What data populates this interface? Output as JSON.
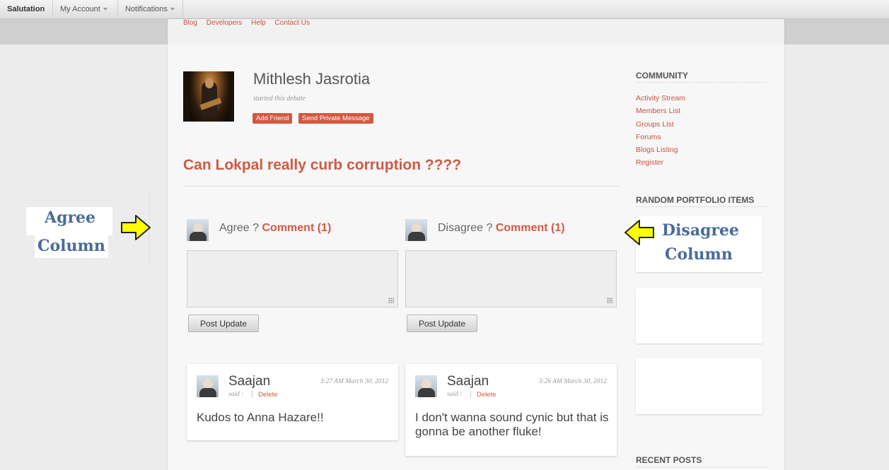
{
  "topbar": {
    "brand": "Salutation",
    "account": "My Account",
    "notifications": "Notifications"
  },
  "nav": [
    "Blog",
    "Developers",
    "Help",
    "Contact Us"
  ],
  "profile": {
    "name": "Mithlesh Jasrotia",
    "subtitle": "started this debate",
    "add_friend": "Add Friend",
    "send_message": "Send Private Message"
  },
  "debate": {
    "title": "Can Lokpal really curb corruption ????",
    "agree": {
      "label": "Agree ?",
      "comment": "Comment (1)",
      "post_button": "Post Update"
    },
    "disagree": {
      "label": "Disagree ?",
      "comment": "Comment (1)",
      "post_button": "Post Update"
    }
  },
  "comments": {
    "agree": {
      "author": "Saajan",
      "said": "said :",
      "delete": "Delete",
      "time": "3:27 AM March 30, 2012",
      "text": "Kudos to Anna Hazare!!"
    },
    "disagree": {
      "author": "Saajan",
      "said": "said :",
      "delete": "Delete",
      "time": "3:26 AM March 30, 2012",
      "text": "I don't wanna sound cynic but that is gonna be another fluke!"
    }
  },
  "sidebar": {
    "community_title": "COMMUNITY",
    "community_links": [
      "Activity Stream",
      "Members List",
      "Groups List",
      "Forums",
      "Blogs Listing",
      "Register"
    ],
    "portfolio_title": "RANDOM PORTFOLIO ITEMS",
    "recent_title": "RECENT POSTS"
  },
  "annotations": {
    "agree_line1": "Agree",
    "agree_line2": "Column",
    "disagree_line1": "Disagree",
    "disagree_line2": "Column"
  },
  "colors": {
    "accent": "#cf5a44",
    "annotation": "#4a6a9a",
    "arrow": "#ffff00"
  }
}
